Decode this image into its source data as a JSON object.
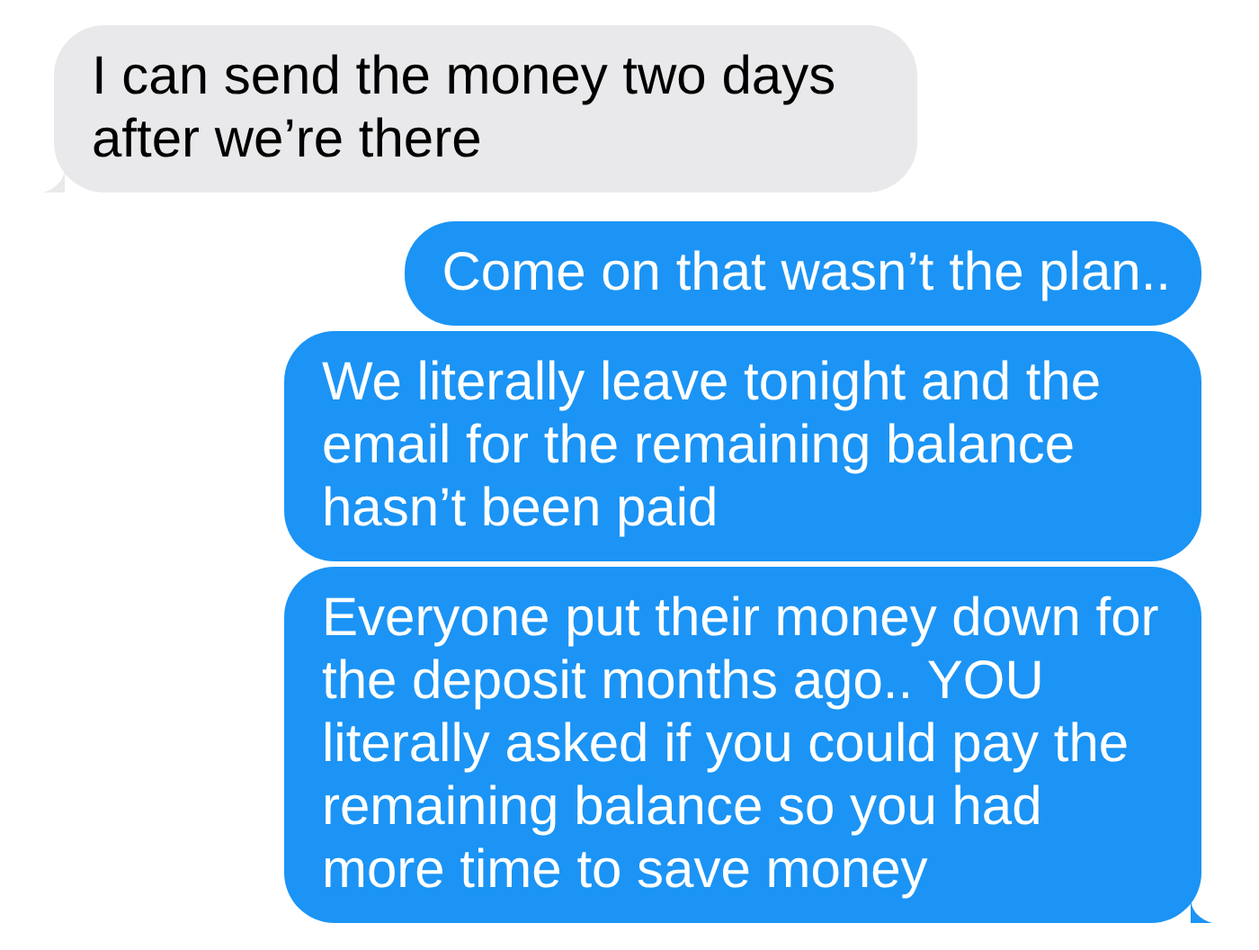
{
  "messages": [
    {
      "kind": "received",
      "text": "I can send the money two days after we’re there",
      "tail": true
    },
    {
      "kind": "sent",
      "text": "Come on that wasn’t the plan..",
      "tail": false
    },
    {
      "kind": "sent",
      "text": "We literally leave tonight and the email for the remaining balance hasn’t been paid",
      "tail": false
    },
    {
      "kind": "sent",
      "text": "Everyone put their money down for the deposit months ago.. YOU literally asked if you could pay the remaining balance so you had more time to save money",
      "tail": true
    }
  ]
}
